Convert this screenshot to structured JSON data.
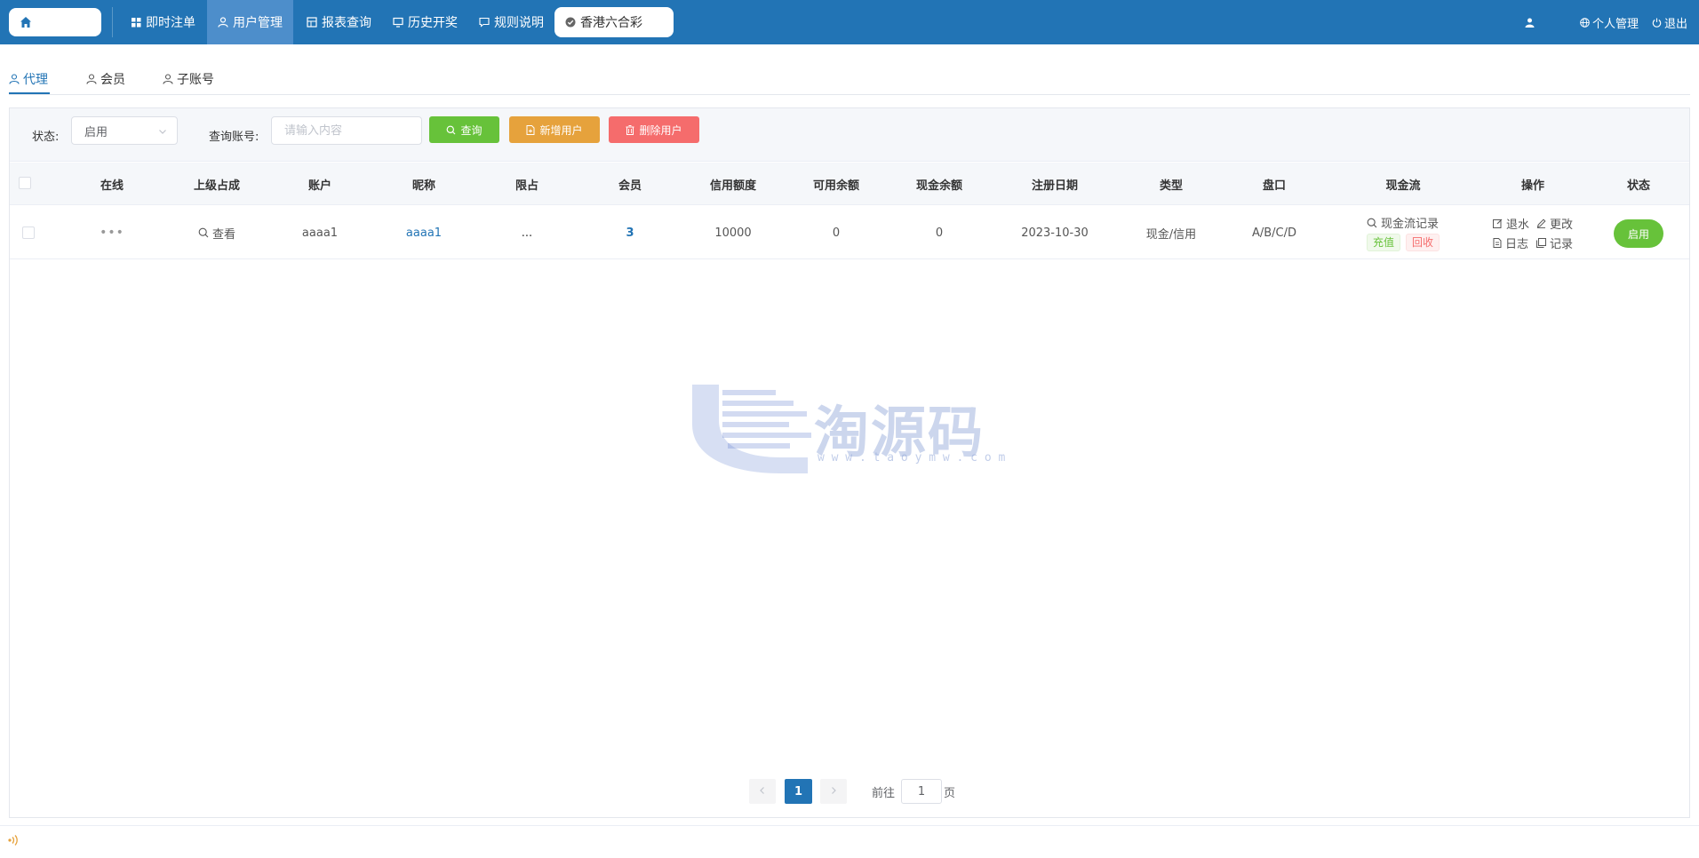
{
  "nav": {
    "items": [
      {
        "label": "即时注单",
        "icon": "grid-icon"
      },
      {
        "label": "用户管理",
        "icon": "user-icon"
      },
      {
        "label": "报表查询",
        "icon": "report-icon"
      },
      {
        "label": "历史开奖",
        "icon": "monitor-icon"
      },
      {
        "label": "规则说明",
        "icon": "message-icon"
      }
    ],
    "lottery": "香港六合彩",
    "profile_label": "个人管理",
    "logout_label": "退出"
  },
  "subtabs": [
    "代理",
    "会员",
    "子账号"
  ],
  "filters": {
    "status_label": "状态:",
    "status_value": "启用",
    "account_label": "查询账号:",
    "account_placeholder": "请输入内容",
    "query_btn": "查询",
    "add_btn": "新增用户",
    "delete_btn": "删除用户"
  },
  "table": {
    "headers": [
      "在线",
      "上级占成",
      "账户",
      "昵称",
      "限占",
      "会员",
      "信用额度",
      "可用余额",
      "现金余额",
      "注册日期",
      "类型",
      "盘口",
      "现金流",
      "操作",
      "状态"
    ],
    "row": {
      "online": "•••",
      "parent_share": "查看",
      "account": "aaaa1",
      "nickname": "aaaa1",
      "limit": "...",
      "members": "3",
      "credit": "10000",
      "available": "0",
      "cash": "0",
      "reg_date": "2023-10-30",
      "type": "现金/信用",
      "handicap": "A/B/C/D",
      "cashflow_record": "现金流记录",
      "recharge": "充值",
      "recycle": "回收",
      "op_rebate": "退水",
      "op_edit": "更改",
      "op_log": "日志",
      "op_record": "记录",
      "status": "启用"
    }
  },
  "watermark": {
    "brand": "淘源码",
    "url": "w w w . t a o y m w . c o m"
  },
  "pager": {
    "current": "1",
    "goto_label": "前往",
    "goto_value": "1",
    "page_unit": "页"
  },
  "colors": {
    "primary": "#2274b5",
    "success": "#67c23a",
    "warning": "#e6a23c",
    "danger": "#f56c6c"
  }
}
